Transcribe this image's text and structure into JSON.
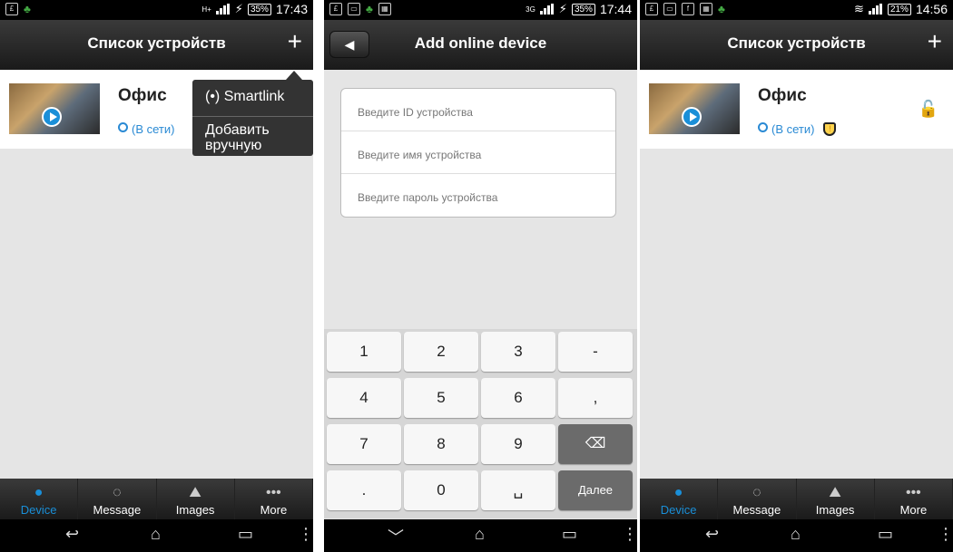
{
  "screens": [
    {
      "status": {
        "battery": "35%",
        "time": "17:43",
        "network": "H+"
      },
      "title": "Список устройств",
      "plus": "+",
      "device": {
        "name": "Офис",
        "status": "(В сети)"
      },
      "popup": {
        "item1": "(•) Smartlink",
        "item2": "Добавить вручную"
      },
      "tabs": [
        {
          "label": "Device",
          "icon": "person-icon"
        },
        {
          "label": "Message",
          "icon": "message-icon"
        },
        {
          "label": "Images",
          "icon": "images-icon"
        },
        {
          "label": "More",
          "icon": "more-icon"
        }
      ]
    },
    {
      "status": {
        "battery": "35%",
        "time": "17:44",
        "network": "3G"
      },
      "title": "Add online device",
      "fields": [
        "Введите ID устройства",
        "Введите имя устройства",
        "Введите пароль устройства"
      ],
      "keys": [
        "1",
        "2",
        "3",
        "-",
        "4",
        "5",
        "6",
        ",",
        "7",
        "8",
        "9",
        "⌫",
        ".",
        "0",
        "␣",
        "Далее"
      ]
    },
    {
      "status": {
        "battery": "21%",
        "time": "14:56"
      },
      "title": "Список устройств",
      "plus": "+",
      "device": {
        "name": "Офис",
        "status": "(В сети)"
      },
      "tabs": [
        {
          "label": "Device",
          "icon": "person-icon"
        },
        {
          "label": "Message",
          "icon": "message-icon"
        },
        {
          "label": "Images",
          "icon": "images-icon"
        },
        {
          "label": "More",
          "icon": "more-icon"
        }
      ]
    }
  ]
}
